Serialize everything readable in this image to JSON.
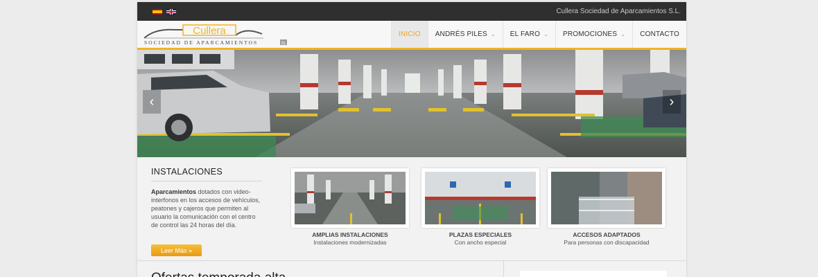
{
  "topbar": {
    "languages": [
      {
        "name": "spanish-flag-icon"
      },
      {
        "name": "uk-flag-icon"
      }
    ],
    "company": "Cullera Sociedad de Aparcamientos S.L."
  },
  "logo": {
    "word": "Cullera",
    "tagline": "SOCIEDAD DE APARCAMIENTOS",
    "suffix": "SL"
  },
  "nav": {
    "items": [
      {
        "label": "INICIO",
        "active": true,
        "dropdown": false
      },
      {
        "label": "ANDRÉS PILES",
        "active": false,
        "dropdown": true
      },
      {
        "label": "EL FARO",
        "active": false,
        "dropdown": true
      },
      {
        "label": "PROMOCIONES",
        "active": false,
        "dropdown": true
      },
      {
        "label": "CONTACTO",
        "active": false,
        "dropdown": false
      }
    ]
  },
  "slider": {
    "prev": "‹",
    "next": "›"
  },
  "installations": {
    "heading": "INSTALACIONES",
    "bold": "Aparcamientos",
    "body": " dotados con video-interfonos en los accesos de vehículos, peatones y cajeros que permiten al usuario la comunicación con el centro de control las 24 horas del día.",
    "button": "Leer Más »"
  },
  "cards": [
    {
      "title": "AMPLIAS INSTALACIONES",
      "subtitle": "Instalaciones modernizadas"
    },
    {
      "title": "PLAZAS ESPECIALES",
      "subtitle": "Con ancho especial"
    },
    {
      "title": "ACCESOS ADAPTADOS",
      "subtitle": "Para personas con discapacidad"
    }
  ],
  "offers": {
    "title": "Ofertas temporada alta"
  },
  "colors": {
    "accent": "#f0b323",
    "topbar": "#2f2f2f",
    "active_nav": "#f0a21e"
  }
}
